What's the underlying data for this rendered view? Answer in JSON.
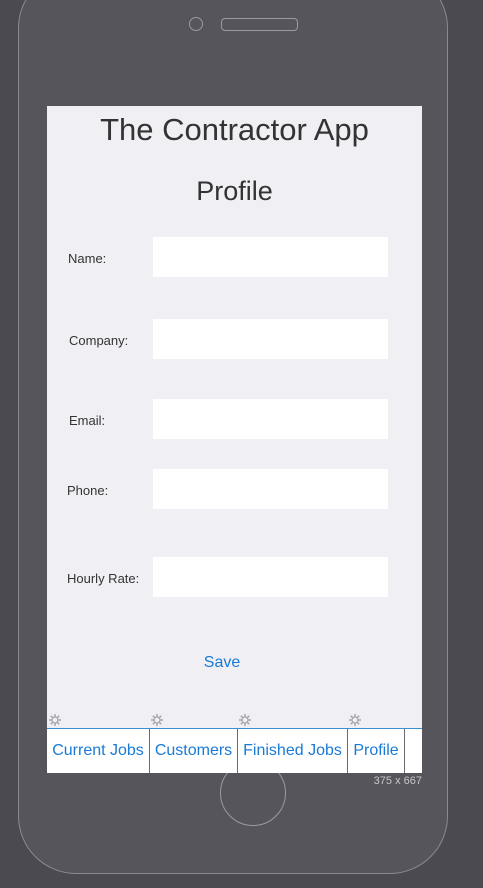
{
  "app": {
    "title": "The Contractor App"
  },
  "page": {
    "title": "Profile"
  },
  "form": {
    "fields": [
      {
        "label": "Name:",
        "value": ""
      },
      {
        "label": "Company:",
        "value": ""
      },
      {
        "label": "Email:",
        "value": ""
      },
      {
        "label": "Phone:",
        "value": ""
      },
      {
        "label": "Hourly Rate:",
        "value": ""
      }
    ],
    "save_label": "Save"
  },
  "tabs": [
    {
      "label": "Current Jobs",
      "icon": "gear-icon"
    },
    {
      "label": "Customers",
      "icon": "gear-icon"
    },
    {
      "label": "Finished Jobs",
      "icon": "gear-icon"
    },
    {
      "label": "Profile",
      "icon": "gear-icon"
    }
  ],
  "device": {
    "screen_size_label": "375 x 667"
  },
  "colors": {
    "accent": "#1a7ad4",
    "screen_bg": "#efeff4",
    "device_bg": "#55555b"
  }
}
